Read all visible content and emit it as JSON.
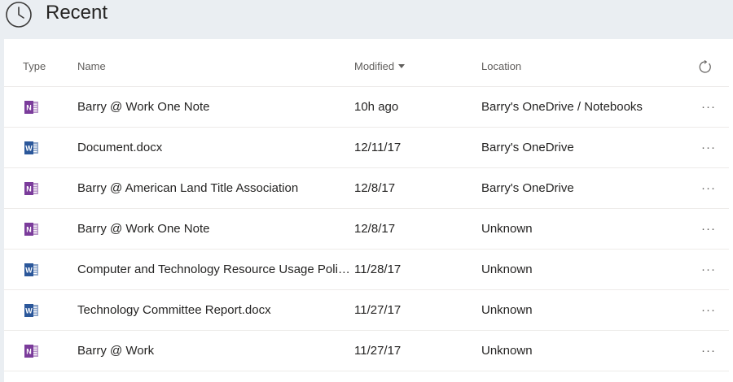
{
  "header": {
    "title": "Recent",
    "icon": "clock-icon"
  },
  "columns": {
    "type": "Type",
    "name": "Name",
    "modified": "Modified",
    "location": "Location",
    "refresh_icon": "refresh-icon",
    "sort_icon": "caret-down-icon"
  },
  "files": [
    {
      "app": "onenote",
      "name": "Barry @ Work One Note",
      "modified": "10h ago",
      "location": "Barry's OneDrive / Notebooks",
      "more": "···"
    },
    {
      "app": "word",
      "name": "Document.docx",
      "modified": "12/11/17",
      "location": "Barry's OneDrive",
      "more": "···"
    },
    {
      "app": "onenote",
      "name": "Barry @ American Land Title Association",
      "modified": "12/8/17",
      "location": "Barry's OneDrive",
      "more": "···"
    },
    {
      "app": "onenote",
      "name": "Barry @ Work One Note",
      "modified": "12/8/17",
      "location": "Unknown",
      "more": "···"
    },
    {
      "app": "word",
      "name": "Computer and Technology Resource Usage Policy...",
      "modified": "11/28/17",
      "location": "Unknown",
      "more": "···"
    },
    {
      "app": "word",
      "name": "Technology Committee Report.docx",
      "modified": "11/27/17",
      "location": "Unknown",
      "more": "···"
    },
    {
      "app": "onenote",
      "name": "Barry @ Work",
      "modified": "11/27/17",
      "location": "Unknown",
      "more": "···"
    }
  ],
  "colors": {
    "onenote": "#7b3c9b",
    "word": "#2b579a",
    "background": "#eaeef2"
  }
}
